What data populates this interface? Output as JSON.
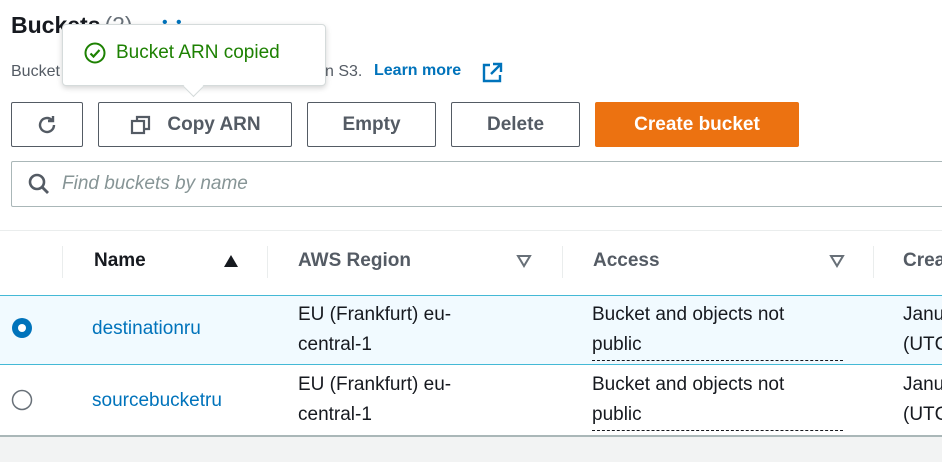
{
  "header": {
    "title": "Buckets",
    "count": "(2)",
    "info": "• •",
    "description_start": "Bucket",
    "description_end": "n S3.",
    "learn_more": "Learn more"
  },
  "tooltip": {
    "message": "Bucket ARN copied"
  },
  "toolbar": {
    "refresh_icon": "refresh-icon",
    "copy_arn_label": "Copy ARN",
    "empty_label": "Empty",
    "delete_label": "Delete",
    "create_label": "Create bucket"
  },
  "search": {
    "placeholder": "Find buckets by name",
    "value": ""
  },
  "table": {
    "columns": [
      "Name",
      "AWS Region",
      "Access",
      "Crea"
    ],
    "rows": [
      {
        "selected": true,
        "name": "destinationru",
        "region_line1": "EU (Frankfurt) eu-",
        "region_line2": "central-1",
        "access_line1": "Bucket and objects not",
        "access_line2": "public",
        "created_line1": "Janu",
        "created_line2": "(UTC"
      },
      {
        "selected": false,
        "name": "sourcebucketru",
        "region_line1": "EU (Frankfurt) eu-",
        "region_line2": "central-1",
        "access_line1": "Bucket and objects not",
        "access_line2": "public",
        "created_line1": "Janu",
        "created_line2": "(UTC"
      }
    ]
  },
  "colors": {
    "accent": "#0073bb",
    "primary_button": "#ec7211",
    "success": "#1d8102",
    "selected_row": "#f1faff"
  }
}
